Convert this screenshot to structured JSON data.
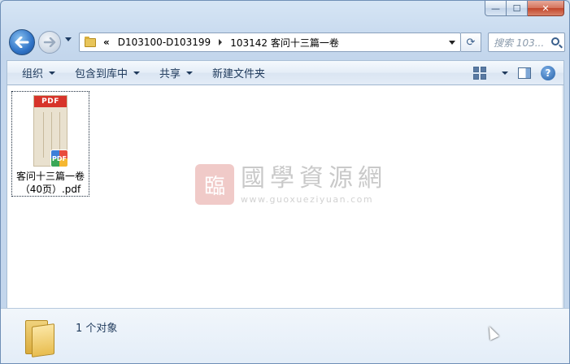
{
  "window": {
    "caption_buttons": {
      "minimize": "—",
      "maximize": "☐",
      "close": "✕"
    }
  },
  "nav": {
    "back_glyph": "←",
    "forward_glyph": "→",
    "address": {
      "overflow": "«",
      "crumbs": [
        "D103100-D103199",
        "103142 客问十三篇一卷"
      ]
    },
    "refresh_glyph": "⟳",
    "search_placeholder": "搜索 103...",
    "icons": [
      "back-arrow-icon",
      "forward-arrow-icon",
      "folder-icon",
      "refresh-icon",
      "search-icon"
    ]
  },
  "toolbar": {
    "items": [
      {
        "label": "组织",
        "has_dropdown": true
      },
      {
        "label": "包含到库中",
        "has_dropdown": true
      },
      {
        "label": "共享",
        "has_dropdown": true
      },
      {
        "label": "新建文件夹",
        "has_dropdown": false
      }
    ],
    "right_icons": [
      "change-view-icon",
      "preview-pane-icon",
      "help-icon"
    ],
    "help_glyph": "?"
  },
  "content": {
    "files": [
      {
        "thumb_label": "PDF",
        "badge_label": "PDF",
        "name_line1": "客问十三篇一卷",
        "name_line2": "（40页）.pdf"
      }
    ],
    "watermark": {
      "seal": "臨",
      "title": "國學資源網",
      "url": "www.guoxueziyuan.com"
    }
  },
  "details": {
    "count_text": "1 个对象"
  },
  "colors": {
    "accent": "#1e395b",
    "pdf_red": "#d7342a",
    "window_frame": "#c9dbef"
  }
}
